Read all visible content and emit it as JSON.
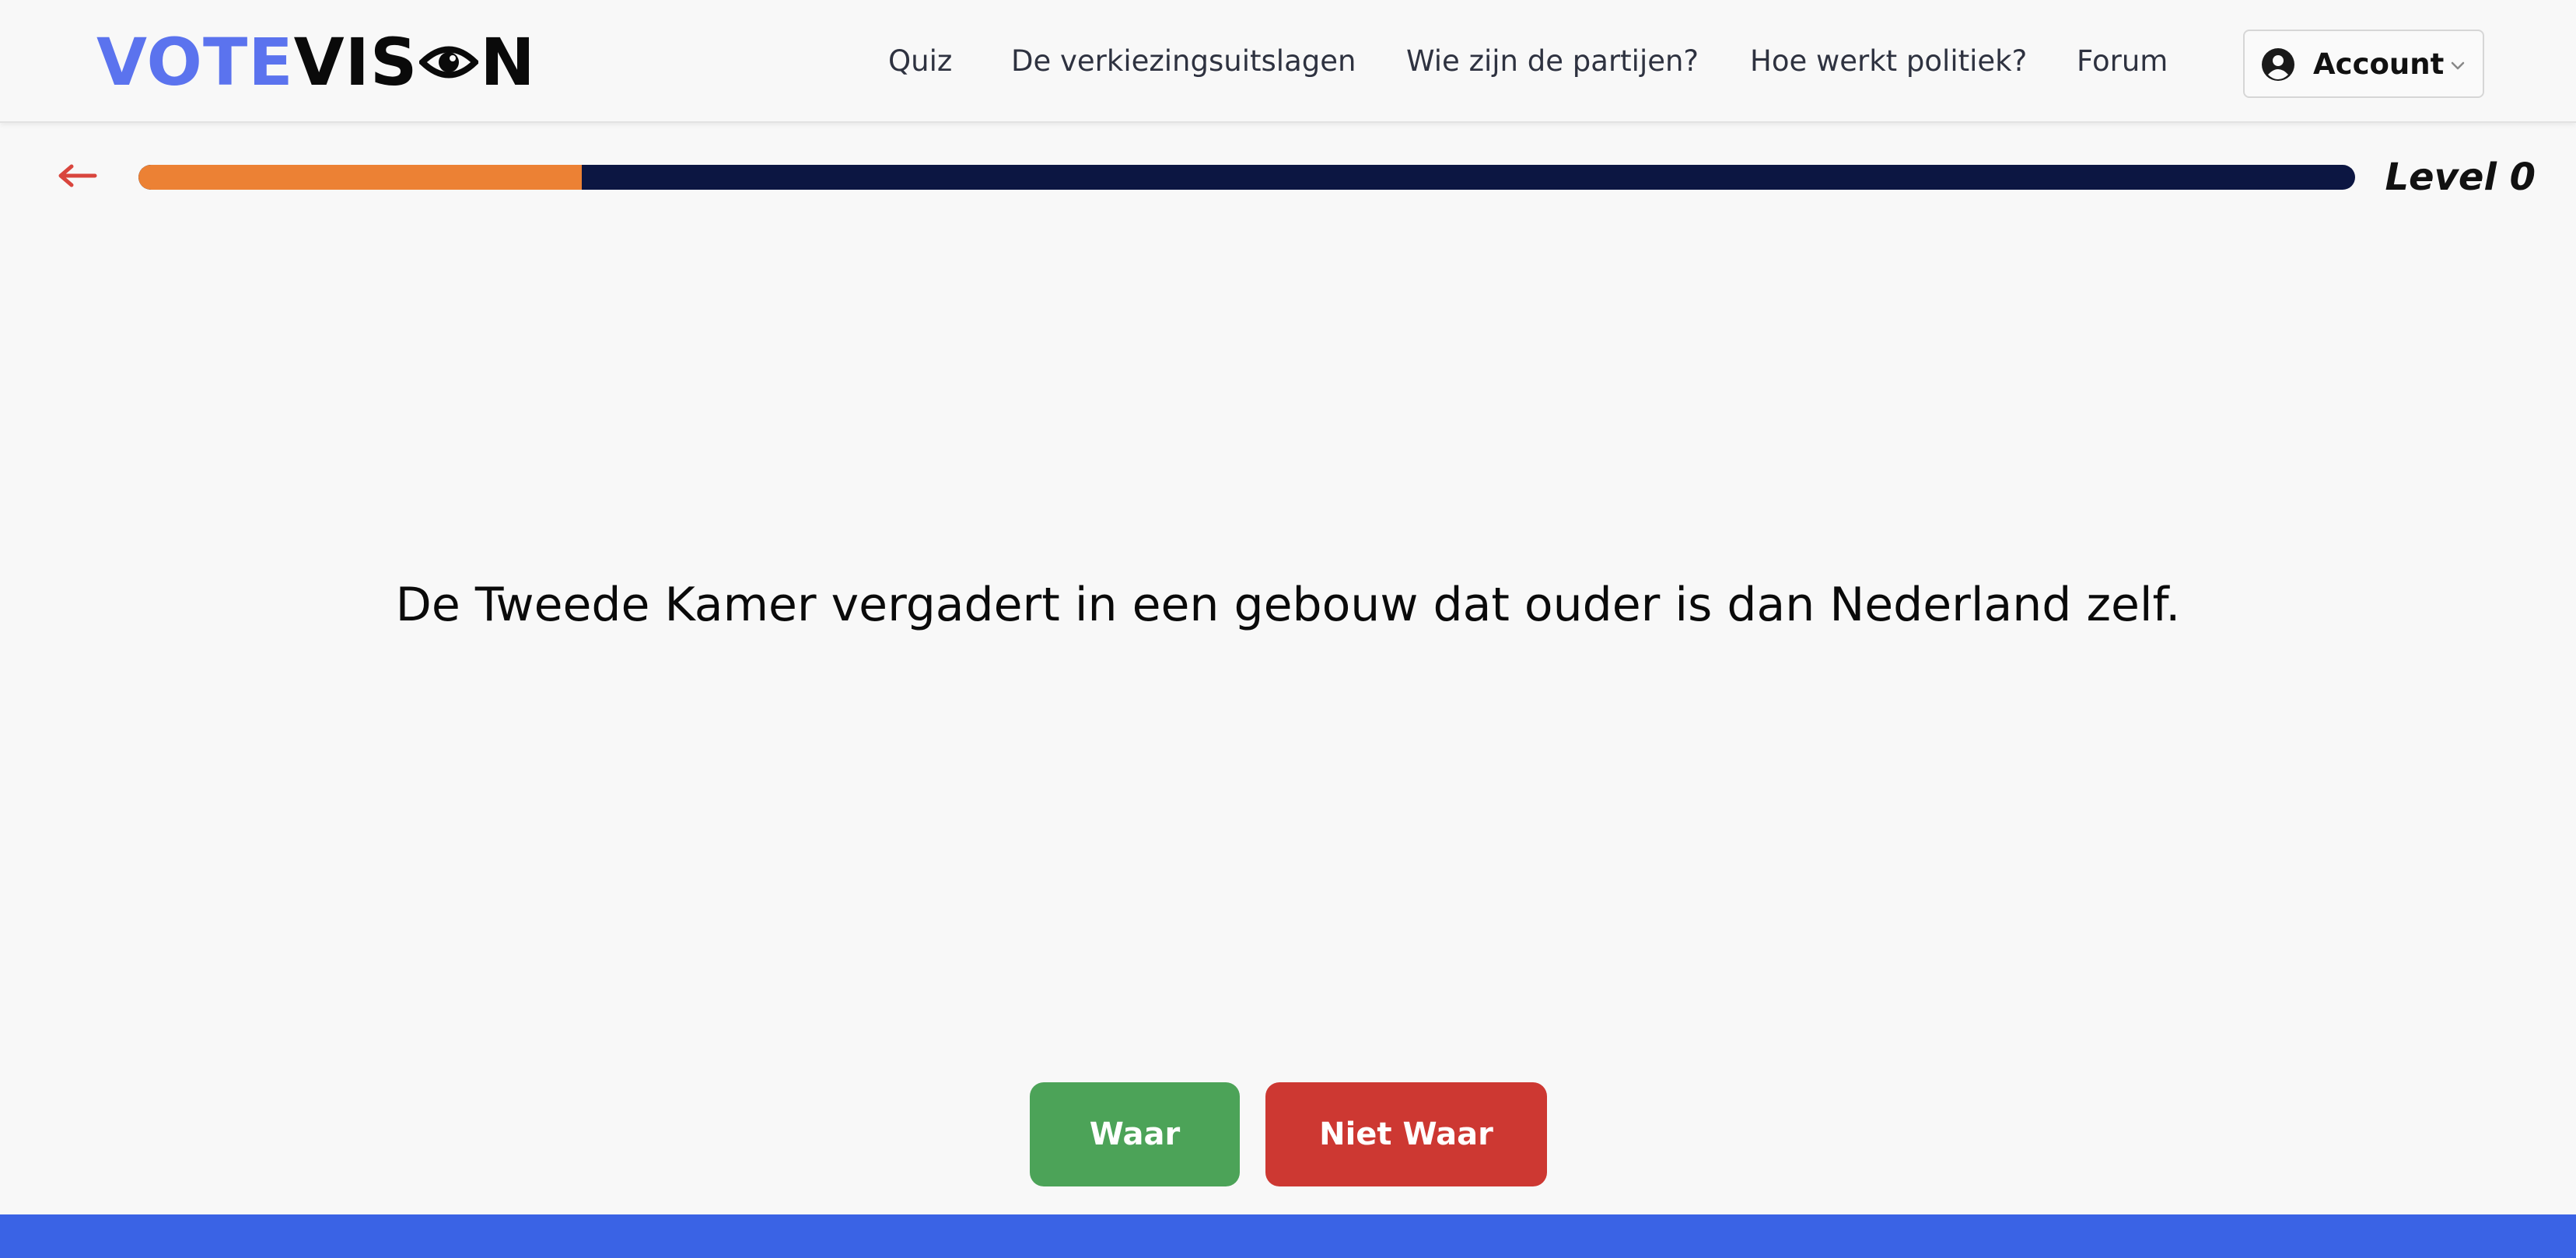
{
  "brand": {
    "part1": "VOTE",
    "part2": "VIS",
    "part3": "N",
    "logo_icon": "eye-icon",
    "colors": {
      "primary": "#5b73ee",
      "dark": "#0a0a0a"
    }
  },
  "nav": {
    "items": [
      {
        "label": "Quiz"
      },
      {
        "label": "De verkiezingsuitslagen"
      },
      {
        "label": "Wie zijn de partijen?"
      },
      {
        "label": "Hoe werkt politiek?"
      },
      {
        "label": "Forum"
      }
    ],
    "account": {
      "label": "Account",
      "icon": "user-circle-icon",
      "dropdown_icon": "chevron-down-icon"
    }
  },
  "quiz": {
    "back_icon": "arrow-left-icon",
    "progress": 0.2,
    "progress_colors": {
      "fill": "#ec8134",
      "track": "#0c1642"
    },
    "level_label": "Level 0",
    "question": "De Tweede Kamer vergadert in een gebouw dat ouder is dan Nederland zelf.",
    "answers": {
      "true_label": "Waar",
      "false_label": "Niet Waar",
      "true_color": "#4ca358",
      "false_color": "#cd3832"
    }
  },
  "footer": {
    "color": "#3a63e5"
  }
}
